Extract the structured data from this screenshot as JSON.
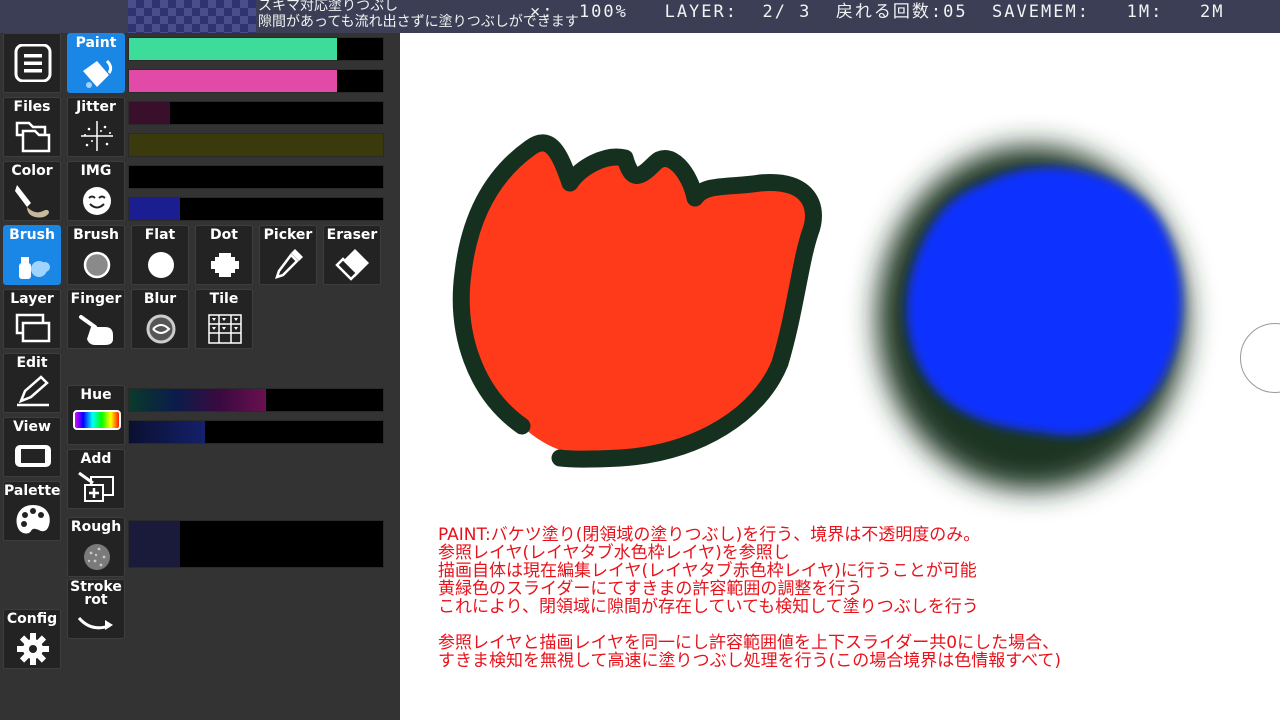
{
  "topbar": {
    "tool_title": "スキマ対応塗りつぶし",
    "tool_desc": "隙間があっても流れ出さずに塗りつぶしができます",
    "status": "×:  100%   LAYER:  2/ 3  戻れる回数:05  SAVEMEM:   1M:   2M"
  },
  "sidebar": {
    "menu_icon": "menu-icon",
    "paint": {
      "label": "Paint",
      "icon": "paint-bucket-icon"
    },
    "files": {
      "label": "Files",
      "icon": "files-icon"
    },
    "jitter": {
      "label": "Jitter",
      "icon": "jitter-icon"
    },
    "color": {
      "label": "Color",
      "icon": "color-tube-icon"
    },
    "img": {
      "label": "IMG",
      "icon": "face-icon"
    },
    "brush_cat": {
      "label": "Brush",
      "icon": "brush-category-icon"
    },
    "layer": {
      "label": "Layer",
      "icon": "layer-icon"
    },
    "edit": {
      "label": "Edit",
      "icon": "edit-pen-icon"
    },
    "view": {
      "label": "View",
      "icon": "view-device-icon"
    },
    "palette": {
      "label": "Palette",
      "icon": "palette-icon"
    },
    "config": {
      "label": "Config",
      "icon": "gear-icon"
    }
  },
  "brushes": [
    {
      "label": "Brush",
      "icon": "round-brush-icon"
    },
    {
      "label": "Flat",
      "icon": "flat-brush-icon"
    },
    {
      "label": "Dot",
      "icon": "dot-brush-icon"
    },
    {
      "label": "Picker",
      "icon": "picker-icon"
    },
    {
      "label": "Eraser",
      "icon": "eraser-icon"
    },
    {
      "label": "Finger",
      "icon": "finger-icon"
    },
    {
      "label": "Blur",
      "icon": "blur-icon"
    },
    {
      "label": "Tile",
      "icon": "tile-icon"
    }
  ],
  "tools": {
    "hue": {
      "label": "Hue",
      "icon": "hue-spectrum-icon"
    },
    "add": {
      "label": "Add",
      "icon": "add-layer-icon"
    },
    "rough": {
      "label": "Rough",
      "icon": "rough-texture-icon"
    },
    "stroke_rot": {
      "label": "Stroke\nrot",
      "icon": "stroke-rotate-icon"
    }
  },
  "sliders": [
    {
      "name": "paint-tolerance-upper",
      "value": 0.82,
      "color": "#3ddc9b"
    },
    {
      "name": "paint-tolerance-lower",
      "value": 0.82,
      "color": "#e24aa8"
    },
    {
      "name": "jitter-amount",
      "value": 0.16,
      "color": "#3a0f2c"
    },
    {
      "name": "jitter-secondary",
      "value": 1.0,
      "color": "#3b3a0c"
    },
    {
      "name": "img-opacity",
      "value": 0.0,
      "color": "#0a1a2a"
    },
    {
      "name": "img-secondary",
      "value": 0.2,
      "color": "#1a1e90"
    },
    {
      "name": "hue-shift",
      "value": 0.54,
      "color": "#6a1050"
    },
    {
      "name": "hue-secondary",
      "value": 0.3,
      "color": "#101a5a"
    },
    {
      "name": "rough-amount",
      "value": 0.2,
      "color": "#1a1a3a"
    }
  ],
  "canvas": {
    "notes": [
      "PAINT:バケツ塗り(閉領域の塗りつぶし)を行う、境界は不透明度のみ。",
      "参照レイヤ(レイヤタブ水色枠レイヤ)を参照し",
      "描画自体は現在編集レイヤ(レイヤタブ赤色枠レイヤ)に行うことが可能",
      "黄緑色のスライダーにてすきまの許容範囲の調整を行う",
      "これにより、閉領域に隙間が存在していても検知して塗りつぶしを行う",
      "",
      "参照レイヤと描画レイヤを同一にし許容範囲値を上下スライダー共0にした場合、",
      "すきま検知を無視して高速に塗りつぶし処理を行う(この場合境界は色情報すべて)"
    ],
    "colors": {
      "red_fill": "#ff3a1a",
      "outline": "#15301f",
      "blue_fill": "#1030ff",
      "blur_ring": "#1d3522"
    }
  }
}
